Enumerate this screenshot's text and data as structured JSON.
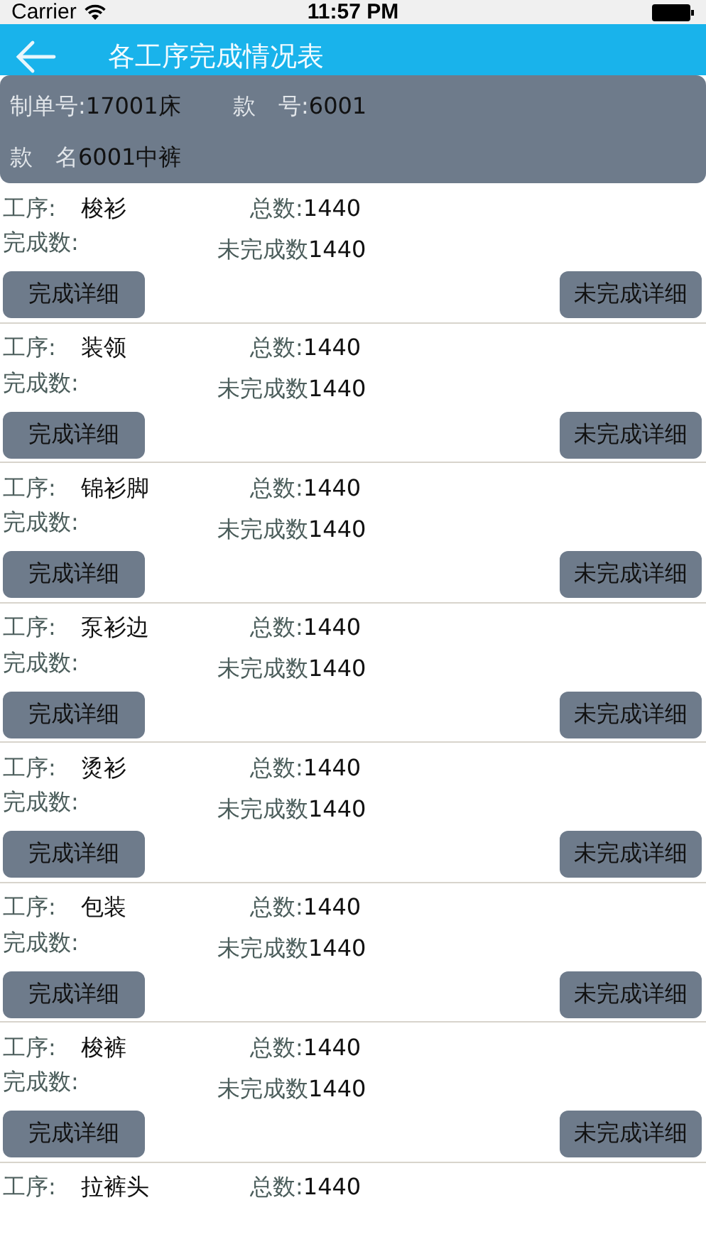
{
  "status_bar": {
    "carrier": "Carrier",
    "time": "11:57 PM"
  },
  "nav_bar": {
    "title": "各工序完成情况表"
  },
  "order": {
    "fields": [
      {
        "label": "制单号:",
        "value": "17001床"
      },
      {
        "label": "款　号:",
        "value": "6001"
      },
      {
        "label": "款　名",
        "value": "6001中裤"
      }
    ]
  },
  "processes": [
    {
      "process_label": "工序:",
      "process": "梭衫",
      "total_label": "总数:",
      "total": "1440",
      "done_label": "完成数:",
      "undone_label": "未完成数",
      "undone": "1440",
      "buttons": [
        "完成详细",
        "未完成详细"
      ]
    },
    {
      "process_label": "工序:",
      "process": "装领",
      "total_label": "总数:",
      "total": "1440",
      "done_label": "完成数:",
      "undone_label": "未完成数",
      "undone": "1440",
      "buttons": [
        "完成详细",
        "未完成详细"
      ]
    },
    {
      "process_label": "工序:",
      "process": "锦衫脚",
      "total_label": "总数:",
      "total": "1440",
      "done_label": "完成数:",
      "undone_label": "未完成数",
      "undone": "1440",
      "buttons": [
        "完成详细",
        "未完成详细"
      ]
    },
    {
      "process_label": "工序:",
      "process": "泵衫边",
      "total_label": "总数:",
      "total": "1440",
      "done_label": "完成数:",
      "undone_label": "未完成数",
      "undone": "1440",
      "buttons": [
        "完成详细",
        "未完成详细"
      ]
    },
    {
      "process_label": "工序:",
      "process": "烫衫",
      "total_label": "总数:",
      "total": "1440",
      "done_label": "完成数:",
      "undone_label": "未完成数",
      "undone": "1440",
      "buttons": [
        "完成详细",
        "未完成详细"
      ]
    },
    {
      "process_label": "工序:",
      "process": "包装",
      "total_label": "总数:",
      "total": "1440",
      "done_label": "完成数:",
      "undone_label": "未完成数",
      "undone": "1440",
      "buttons": [
        "完成详细",
        "未完成详细"
      ]
    },
    {
      "process_label": "工序:",
      "process": "梭裤",
      "total_label": "总数:",
      "total": "1440",
      "done_label": "完成数:",
      "undone_label": "未完成数",
      "undone": "1440",
      "buttons": [
        "完成详细",
        "未完成详细"
      ]
    },
    {
      "process_label": "工序:",
      "process": "拉裤头",
      "total_label": "总数:",
      "total": "1440"
    }
  ]
}
